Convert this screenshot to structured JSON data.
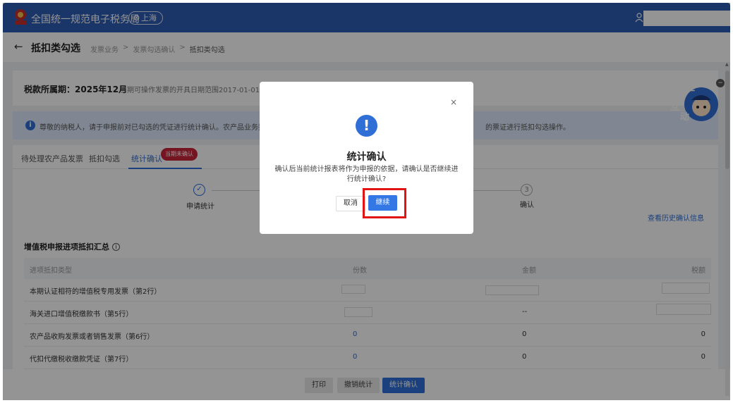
{
  "header": {
    "app_title": "全国统一规范电子税务局",
    "region": "上海",
    "logo_icon": "tax-emblem-icon",
    "user_icon": "user-icon"
  },
  "subheader": {
    "page_title": "抵扣类勾选",
    "breadcrumbs": [
      "发票业务",
      "发票勾选确认",
      "抵扣类勾选"
    ]
  },
  "period": {
    "label": "税款所属期：",
    "value": "2025年12月",
    "description": "当期可操作发票的开具日期范围2017-01-01至2"
  },
  "notice": {
    "text_left": "尊敬的纳税人，请于申报前对已勾选的凭证进行统计确认。农产品业务抵扣",
    "text_right": "的票证进行抵扣勾选操作。"
  },
  "tabs": [
    {
      "label": "待处理农产品发票"
    },
    {
      "label": "抵扣勾选"
    },
    {
      "label": "统计确认"
    }
  ],
  "tab_badge": "当期未确认",
  "steps": {
    "step1_label": "申请统计",
    "step3_number": "3",
    "step3_label": "确认"
  },
  "history_link": "查看历史确认信息",
  "summary": {
    "title": "增值税申报进项抵扣汇总",
    "headers": [
      "进项抵扣类型",
      "份数",
      "金额",
      "税额"
    ],
    "rows": [
      {
        "type": "本期认证相符的增值税专用发票（第2行）",
        "count": "",
        "amount": "",
        "tax": ""
      },
      {
        "type": "海关进口增值税缴款书（第5行）",
        "count": "",
        "amount": "--",
        "tax": ""
      },
      {
        "type": "农产品收购发票或者销售发票（第6行）",
        "count": "0",
        "amount": "0",
        "tax": "0"
      },
      {
        "type": "代扣代缴税收缴款凭证（第7行）",
        "count": "0",
        "amount": "0",
        "tax": "0"
      }
    ]
  },
  "bottom_actions": {
    "print": "打印",
    "undo": "撤销统计",
    "confirm": "统计确认"
  },
  "mascot": {
    "text": [
      "征",
      "纳",
      "互",
      "动"
    ]
  },
  "modal": {
    "close": "×",
    "icon": "!",
    "title": "统计确认",
    "body": "确认后当前统计报表将作为申报的依据，请确认是否继续进行统计确认?",
    "cancel": "取消",
    "continue": "继续"
  },
  "colors": {
    "header_bg": "#2d5cb3",
    "accent": "#2d6fd8",
    "badge": "#c8253a",
    "highlight": "#e21313"
  }
}
